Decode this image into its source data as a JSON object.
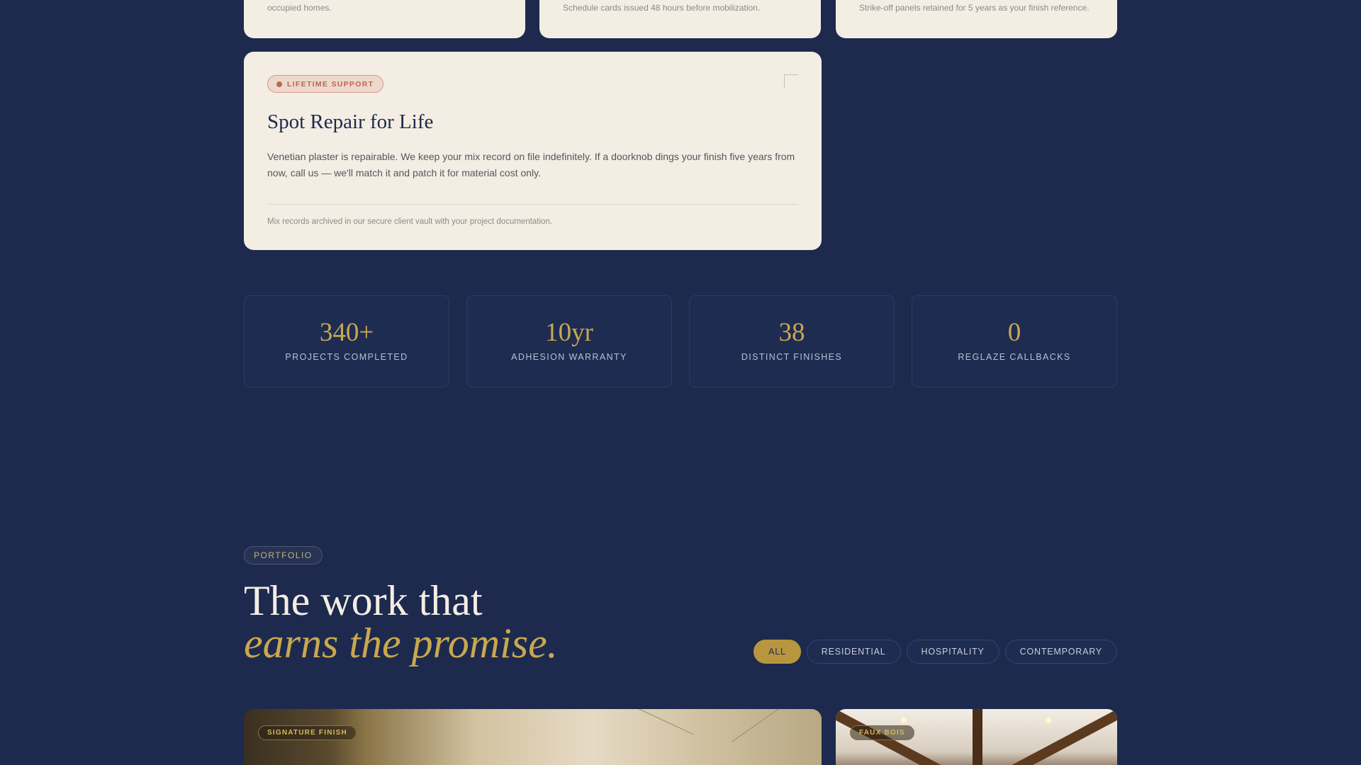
{
  "process_cards": [
    {
      "note": "occupied homes."
    },
    {
      "note": "Schedule cards issued 48 hours before mobilization."
    },
    {
      "note": "Strike-off panels retained for 5 years as your finish reference."
    }
  ],
  "support_card": {
    "badge": "LIFETIME SUPPORT",
    "title": "Spot Repair for Life",
    "body": "Venetian plaster is repairable. We keep your mix record on file indefinitely. If a doorknob dings your finish five years from now, call us — we'll match it and patch it for material cost only.",
    "footnote": "Mix records archived in our secure client vault with your project documentation."
  },
  "stats": [
    {
      "value": "340+",
      "label": "PROJECTS COMPLETED"
    },
    {
      "value": "10yr",
      "label": "ADHESION WARRANTY"
    },
    {
      "value": "38",
      "label": "DISTINCT FINISHES"
    },
    {
      "value": "0",
      "label": "REGLAZE CALLBACKS"
    }
  ],
  "portfolio": {
    "eyebrow": "PORTFOLIO",
    "heading_line1": "The work that",
    "heading_line2": "earns the promise.",
    "filters": [
      "ALL",
      "RESIDENTIAL",
      "HOSPITALITY",
      "CONTEMPORARY"
    ],
    "active_filter": "ALL",
    "tiles": [
      {
        "tag": "SIGNATURE FINISH"
      },
      {
        "tag": "FAUX BOIS"
      }
    ]
  },
  "colors": {
    "background": "#1d2a4e",
    "card": "#f4ede3",
    "gold": "#c9a84e",
    "accent_rust": "#c0664e"
  }
}
